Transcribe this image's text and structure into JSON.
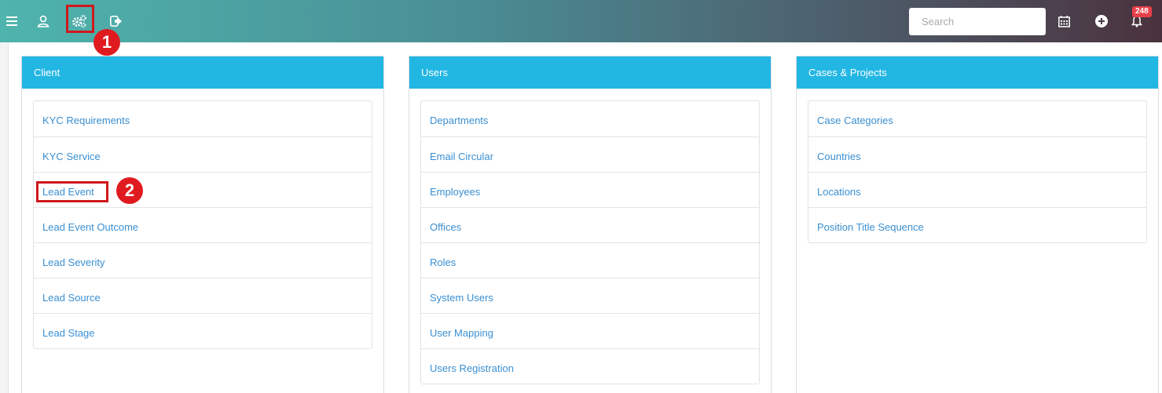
{
  "topbar": {
    "search_placeholder": "Search",
    "notification_count": "248",
    "step_1": "1",
    "step_2": "2"
  },
  "panels": [
    {
      "title": "Client",
      "items": [
        "KYC Requirements",
        "KYC Service",
        "Lead Event",
        "Lead Event Outcome",
        "Lead Severity",
        "Lead Source",
        "Lead Stage"
      ]
    },
    {
      "title": "Users",
      "items": [
        "Departments",
        "Email Circular",
        "Employees",
        "Offices",
        "Roles",
        "System Users",
        "User Mapping",
        "Users Registration"
      ]
    },
    {
      "title": "Cases & Projects",
      "items": [
        "Case Categories",
        "Countries",
        "Locations",
        "Position Title Sequence"
      ]
    }
  ],
  "colors": {
    "panel_header": "#22b6e3",
    "link": "#3a8fd1",
    "highlight": "#d0171b",
    "badge": "#e8414a"
  }
}
